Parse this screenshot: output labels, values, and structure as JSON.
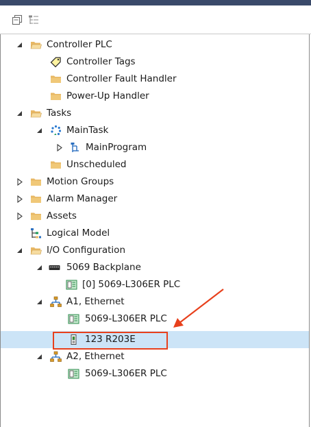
{
  "tree": [
    {
      "label": "Controller PLC",
      "icon": "folder-open-icon",
      "expander": "expanded"
    },
    {
      "label": "Controller Tags",
      "icon": "tag-icon",
      "expander": "none"
    },
    {
      "label": "Controller Fault Handler",
      "icon": "folder-icon",
      "expander": "none"
    },
    {
      "label": "Power-Up Handler",
      "icon": "folder-icon",
      "expander": "none"
    },
    {
      "label": "Tasks",
      "icon": "folder-open-icon",
      "expander": "expanded"
    },
    {
      "label": "MainTask",
      "icon": "task-cycle-icon",
      "expander": "expanded"
    },
    {
      "label": "MainProgram",
      "icon": "program-icon",
      "expander": "collapsed"
    },
    {
      "label": "Unscheduled",
      "icon": "folder-icon",
      "expander": "none"
    },
    {
      "label": "Motion Groups",
      "icon": "folder-icon",
      "expander": "collapsed"
    },
    {
      "label": "Alarm Manager",
      "icon": "folder-icon",
      "expander": "collapsed"
    },
    {
      "label": "Assets",
      "icon": "folder-icon",
      "expander": "collapsed"
    },
    {
      "label": "Logical Model",
      "icon": "logical-model-icon",
      "expander": "none"
    },
    {
      "label": "I/O Configuration",
      "icon": "folder-open-icon",
      "expander": "expanded"
    },
    {
      "label": "5069 Backplane",
      "icon": "backplane-icon",
      "expander": "expanded"
    },
    {
      "label": "[0] 5069-L306ER PLC",
      "icon": "controller-module-icon",
      "expander": "none"
    },
    {
      "label": "A1, Ethernet",
      "icon": "ethernet-network-icon",
      "expander": "expanded"
    },
    {
      "label": "5069-L306ER PLC",
      "icon": "controller-module-icon",
      "expander": "none"
    },
    {
      "label": "123 R203E",
      "icon": "io-device-icon",
      "expander": "none",
      "selected": true
    },
    {
      "label": "A2, Ethernet",
      "icon": "ethernet-network-icon",
      "expander": "expanded"
    },
    {
      "label": "5069-L306ER PLC",
      "icon": "controller-module-icon",
      "expander": "none"
    }
  ],
  "colors": {
    "selection": "#cce4f7",
    "annotation": "#e8401c",
    "folder": "#e8b865",
    "network": "#d89b2a"
  }
}
